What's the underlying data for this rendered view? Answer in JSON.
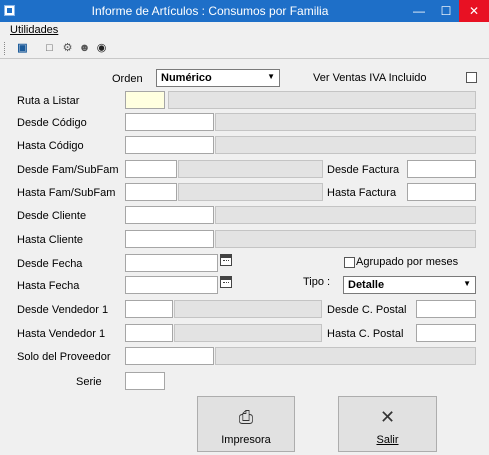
{
  "window": {
    "title": "Informe de Artículos : Consumos por Familia"
  },
  "menu": {
    "utilidades": "Utilidades"
  },
  "toolbar": {
    "buttons": [
      "export",
      "preview",
      "settings",
      "users",
      "search"
    ]
  },
  "form": {
    "orden_label": "Orden",
    "orden_value": "Numérico",
    "iva_label": "Ver Ventas IVA Incluido",
    "iva_checked": false,
    "ruta_label": "Ruta a Listar",
    "desde_codigo_label": "Desde Código",
    "hasta_codigo_label": "Hasta Código",
    "desde_fam_label": "Desde Fam/SubFam",
    "hasta_fam_label": "Hasta Fam/SubFam",
    "desde_factura_label": "Desde Factura",
    "hasta_factura_label": "Hasta Factura",
    "desde_cliente_label": "Desde Cliente",
    "hasta_cliente_label": "Hasta Cliente",
    "desde_fecha_label": "Desde Fecha",
    "hasta_fecha_label": "Hasta Fecha",
    "agrupado_label": "Agrupado por meses",
    "agrupado_checked": false,
    "tipo_label": "Tipo :",
    "tipo_value": "Detalle",
    "desde_vendedor_label": "Desde Vendedor 1",
    "hasta_vendedor_label": "Hasta Vendedor 1",
    "desde_cpostal_label": "Desde C. Postal",
    "hasta_cpostal_label": "Hasta C. Postal",
    "proveedor_label": "Solo del Proveedor",
    "serie_label": "Serie"
  },
  "buttons": {
    "impresora": "Impresora",
    "salir": "Salir"
  }
}
